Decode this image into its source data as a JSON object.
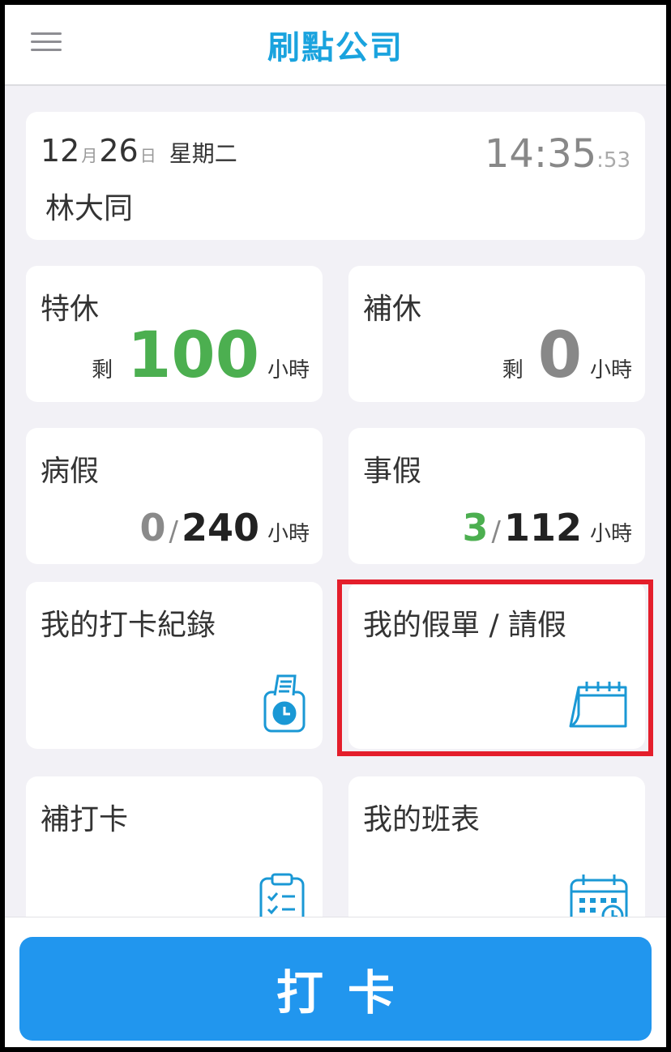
{
  "header": {
    "title": "刷點公司",
    "menu_icon": "hamburger-menu-icon"
  },
  "date_card": {
    "month": "12",
    "month_unit": "月",
    "day": "26",
    "day_unit": "日",
    "weekday": "星期二",
    "user_name": "林大同",
    "time_hm": "14:35",
    "time_sec": ":53"
  },
  "leave_balances": {
    "special": {
      "label": "特休",
      "remain_label": "剩",
      "value": "100",
      "unit": "小時"
    },
    "comp": {
      "label": "補休",
      "remain_label": "剩",
      "value": "0",
      "unit": "小時"
    },
    "sick": {
      "label": "病假",
      "used": "0",
      "slash": "/",
      "total": "240",
      "unit": "小時"
    },
    "personal": {
      "label": "事假",
      "used": "3",
      "slash": "/",
      "total": "112",
      "unit": "小時"
    }
  },
  "menu_tiles": {
    "punch_records": {
      "label": "我的打卡紀錄",
      "icon": "time-clock-card-icon"
    },
    "leave_requests": {
      "label": "我的假單 / 請假",
      "icon": "calendar-icon"
    },
    "make_up_punch": {
      "label": "補打卡",
      "icon": "clipboard-checklist-icon"
    },
    "my_schedule": {
      "label": "我的班表",
      "icon": "calendar-clock-icon"
    }
  },
  "bottom": {
    "punch_button_label": "打卡"
  },
  "colors": {
    "brand": "#1aa3de",
    "button": "#2196ee",
    "green": "#4caf50",
    "highlight": "#e41e2b",
    "background": "#f2f1f6"
  }
}
